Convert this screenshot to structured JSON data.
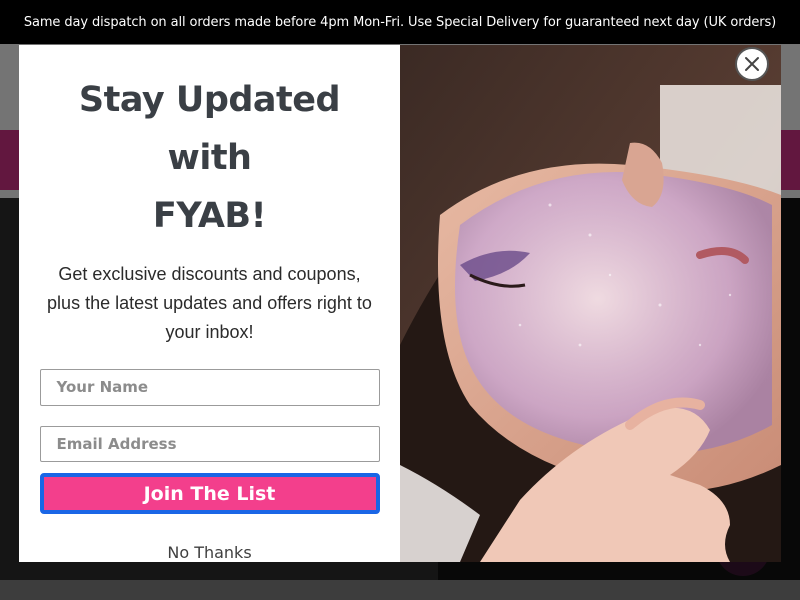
{
  "announcement": {
    "text": "Same day dispatch on all orders made before 4pm Mon-Fri. Use Special Delivery for guaranteed next day (UK orders)"
  },
  "popup": {
    "title_line1": "Stay Updated with",
    "title_line2": "FYAB!",
    "description": "Get exclusive discounts and coupons, plus the latest updates and offers right to your inbox!",
    "name_placeholder": "Your Name",
    "email_placeholder": "Email Address",
    "join_label": "Join The List",
    "no_thanks_label": "No Thanks",
    "image_alt": "facial-treatment-photo"
  },
  "colors": {
    "announcement_bg": "#000000",
    "brand_pink": "#c52e7f",
    "join_button": "#f33f8c",
    "join_button_border": "#1a66e6",
    "title_text": "#3a3f45"
  },
  "icons": {
    "close": "close-icon",
    "chat": "chat-icon"
  }
}
